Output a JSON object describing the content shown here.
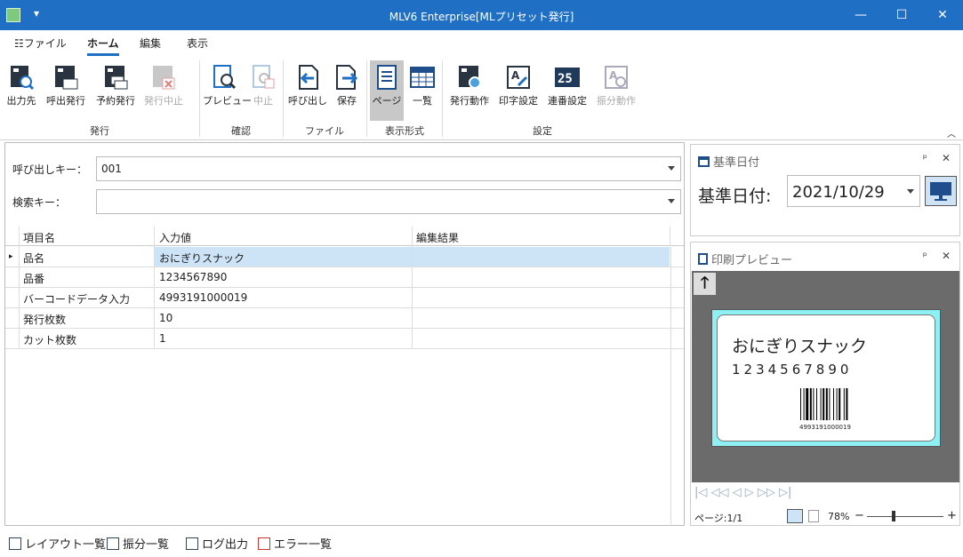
{
  "window": {
    "title": "MLV6 Enterprise[MLプリセット発行]",
    "qa": "▾",
    "min": "—",
    "max": "☐",
    "close": "✕"
  },
  "menu": {
    "file": "☷ファイル",
    "home": "ホーム",
    "edit": "編集",
    "view": "表示"
  },
  "ribbon": {
    "buttons": [
      "出力先",
      "呼出発行",
      "予約発行",
      "発行中止",
      "プレビュー",
      "中止",
      "呼び出し",
      "保存",
      "ページ",
      "一覧",
      "発行動作",
      "印字設定",
      "連番設定",
      "振分動作"
    ],
    "groups": [
      "発行",
      "確認",
      "ファイル",
      "表示形式",
      "設定"
    ],
    "collapse": "︿"
  },
  "form": {
    "call_key_label": "呼び出しキー：",
    "call_key_value": "001",
    "search_key_label": "検索キー：",
    "search_key_value": ""
  },
  "grid": {
    "headers": [
      "項目名",
      "入力値",
      "編集結果"
    ],
    "rows": [
      {
        "name": "品名",
        "value": "おにぎりスナック",
        "result": ""
      },
      {
        "name": "品番",
        "value": "1234567890",
        "result": ""
      },
      {
        "name": "バーコードデータ入力",
        "value": "4993191000019",
        "result": ""
      },
      {
        "name": "発行枚数",
        "value": "10",
        "result": ""
      },
      {
        "name": "カット枚数",
        "value": "1",
        "result": ""
      }
    ],
    "row_marker": "▸"
  },
  "date_panel": {
    "title": "基準日付",
    "pin": "ᵖ",
    "close": "✕",
    "label": "基準日付:",
    "value": "2021/10/29"
  },
  "preview_panel": {
    "title": "印刷プレビュー",
    "pin": "ᵖ",
    "close": "✕",
    "up": "🡑",
    "label_name": "おにぎりスナック",
    "label_code": "1234567890",
    "label_barcode": "4993191000019",
    "nav": "|◁  ◁◁  ◁  ▷  ▷▷  ▷|",
    "page": "ページ:1/1",
    "zoom": "78%",
    "zoom_minus": "−",
    "zoom_plus": "+",
    "zoom_level": 0.35
  },
  "footer": {
    "layout_list": "レイアウト一覧",
    "sort_list": "振分一覧",
    "log_output": "ログ出力",
    "error_list": "エラー一覧"
  }
}
